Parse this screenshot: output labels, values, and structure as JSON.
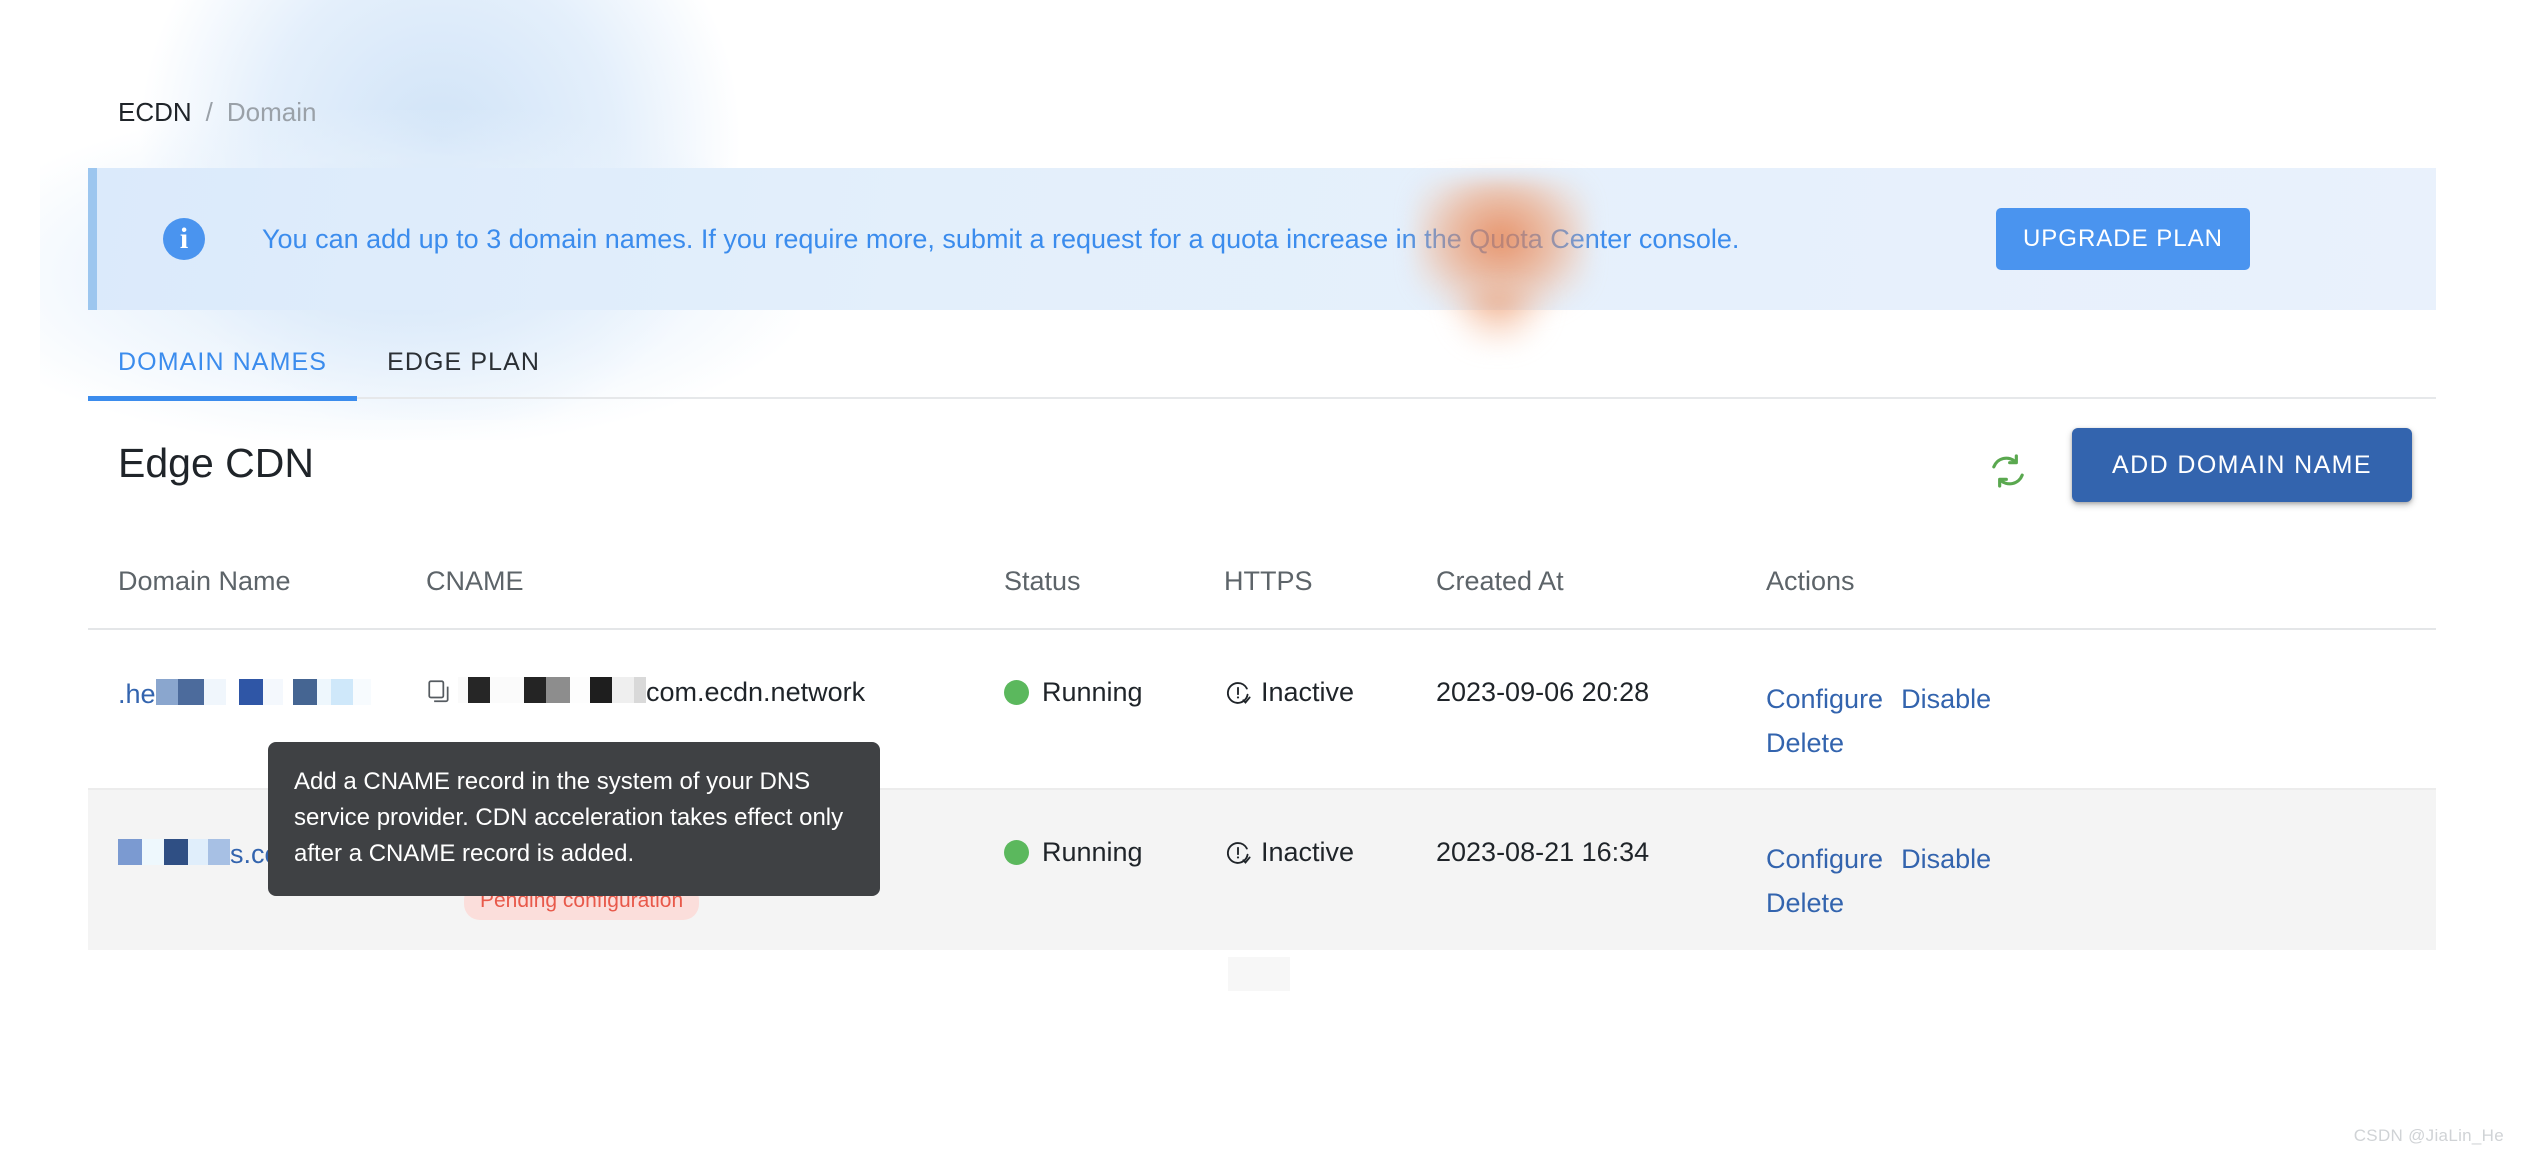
{
  "breadcrumb": {
    "root": "ECDN",
    "separator": "/",
    "current": "Domain"
  },
  "alert": {
    "icon": "info-icon",
    "message": "You can add up to 3 domain names. If you require more, submit a request for a quota increase in the Quota Center console.",
    "button_label": "UPGRADE PLAN",
    "accent_color": "#4a94ef"
  },
  "tabs": [
    {
      "label": "DOMAIN NAMES",
      "active": true
    },
    {
      "label": "EDGE PLAN",
      "active": false
    }
  ],
  "card": {
    "title": "Edge CDN",
    "refresh_icon": "refresh-icon",
    "refresh_color": "#5aa84f",
    "add_button_label": "ADD DOMAIN NAME",
    "add_button_color": "#3364ae"
  },
  "table": {
    "columns": [
      "Domain Name",
      "CNAME",
      "Status",
      "HTTPS",
      "Created At",
      "Actions"
    ],
    "rows": [
      {
        "domain_prefix": ".he",
        "domain_redacted": true,
        "cname_suffix": "com.ecdn.network",
        "cname_copy_icon": "copy-icon",
        "status": "Running",
        "status_color": "#5bb85d",
        "https": "Inactive",
        "https_icon": "alert-circle-icon",
        "created_at": "2023-09-06 20:28",
        "actions": [
          "Configure",
          "Disable",
          "Delete"
        ],
        "badge": ""
      },
      {
        "domain_prefix": "",
        "domain_suffix": "s.com",
        "domain_redacted": true,
        "cname_suffix": "",
        "cname_copy_icon": "copy-icon",
        "status": "Running",
        "status_color": "#5bb85d",
        "https": "Inactive",
        "https_icon": "alert-circle-icon",
        "created_at": "2023-08-21 16:34",
        "actions": [
          "Configure",
          "Disable",
          "Delete"
        ],
        "badge": "Pending configuration",
        "badge_bg": "#fbdedb",
        "badge_color": "#e8594a"
      }
    ]
  },
  "tooltip": {
    "text": "Add a CNAME record in the system of your DNS service provider. CDN acceleration takes effect only after a CNAME record is added."
  },
  "watermark": "CSDN @JiaLin_He"
}
